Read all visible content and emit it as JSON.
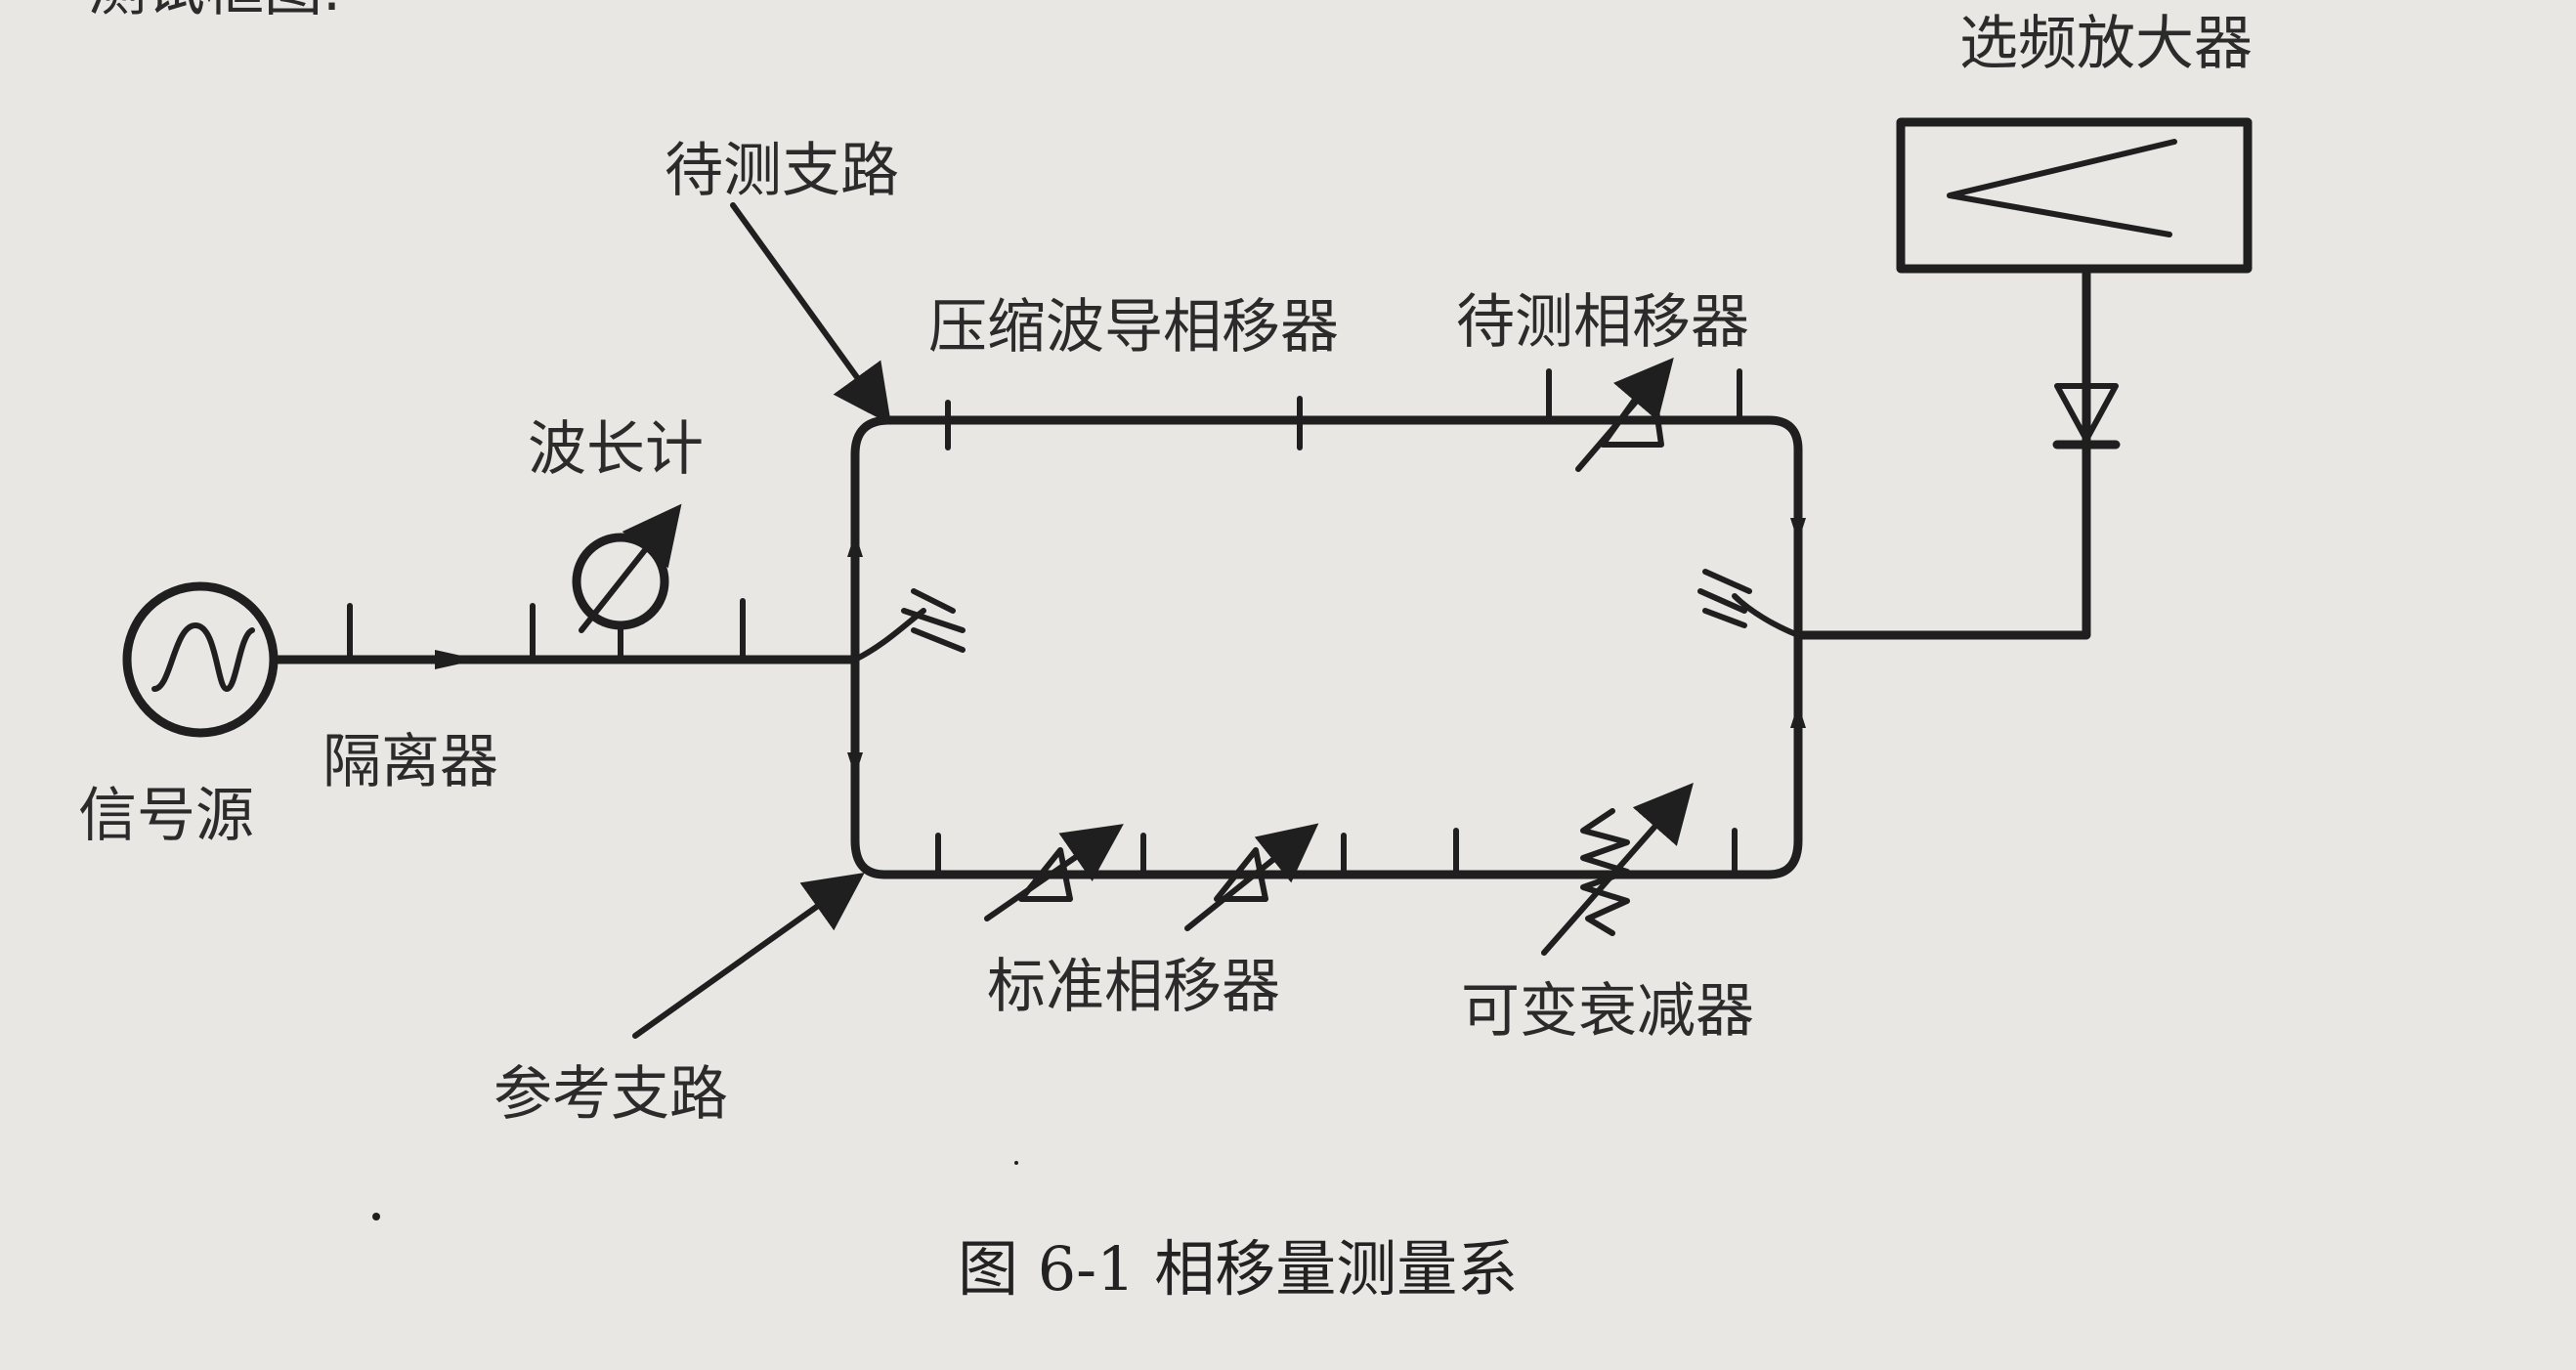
{
  "labels": {
    "top_cutoff": "测试框图.",
    "signal_source": "信号源",
    "isolator": "隔离器",
    "wavemeter": "波长计",
    "test_branch": "待测支路",
    "compressed_phase_shifter": "压缩波导相移器",
    "test_phase_shifter": "待测相移器",
    "selective_amplifier": "选频放大器",
    "reference_branch": "参考支路",
    "standard_phase_shifter": "标准相移器",
    "variable_attenuator": "可变衰减器"
  },
  "caption": "图 6-1 相移量测量系"
}
